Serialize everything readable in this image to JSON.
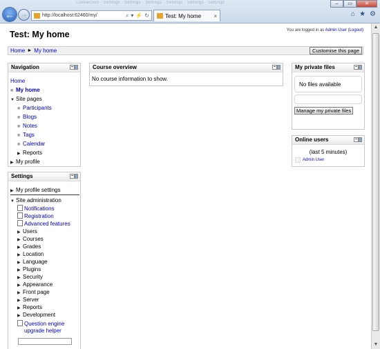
{
  "browser": {
    "blurred_tabs": "Connection  ·  Settings  ·  Settings  ·  Settings  ·  Settings  ·  Settings  ·  Settings",
    "url": "http://localhost:62460/my/",
    "tab_title": "Test: My home",
    "window_buttons": [
      "–",
      "▭",
      "✕"
    ],
    "address_icons": [
      "⌕",
      "▾",
      "⚡",
      "↻"
    ],
    "right_icons": [
      "⌂",
      "★",
      "⚙"
    ]
  },
  "page": {
    "title": "Test: My home",
    "login_prefix": "You are logged in as ",
    "login_user": "Admin User",
    "logout": "(Logout)",
    "breadcrumb": {
      "home": "Home",
      "sep": "►",
      "current": "My home"
    },
    "customise_button": "Customise this page"
  },
  "navigation": {
    "title": "Navigation",
    "home": "Home",
    "my_home": "My home",
    "site_pages": "Site pages",
    "site_items": [
      "Participants",
      "Blogs",
      "Notes",
      "Tags",
      "Calendar"
    ],
    "reports": "Reports",
    "my_profile": "My profile"
  },
  "settings": {
    "title": "Settings",
    "my_profile_settings": "My profile settings",
    "site_administration": "Site administration",
    "doc_links": [
      "Notifications",
      "Registration",
      "Advanced features"
    ],
    "sections": [
      "Users",
      "Courses",
      "Grades",
      "Location",
      "Language",
      "Plugins",
      "Security",
      "Appearance",
      "Front page",
      "Server",
      "Reports",
      "Development"
    ],
    "question_engine_line1": "Question engine",
    "question_engine_line2": "upgrade helper"
  },
  "course_overview": {
    "title": "Course overview",
    "message": "No course information to show."
  },
  "private_files": {
    "title": "My private files",
    "message": "No files available",
    "button": "Manage my private files"
  },
  "online_users": {
    "title": "Online users",
    "period": "(last 5 minutes)",
    "user": "Admin User"
  },
  "colors": {
    "link": "#0000cc",
    "chrome": "#dfe9f5",
    "block_border": "#c8c8c8"
  }
}
